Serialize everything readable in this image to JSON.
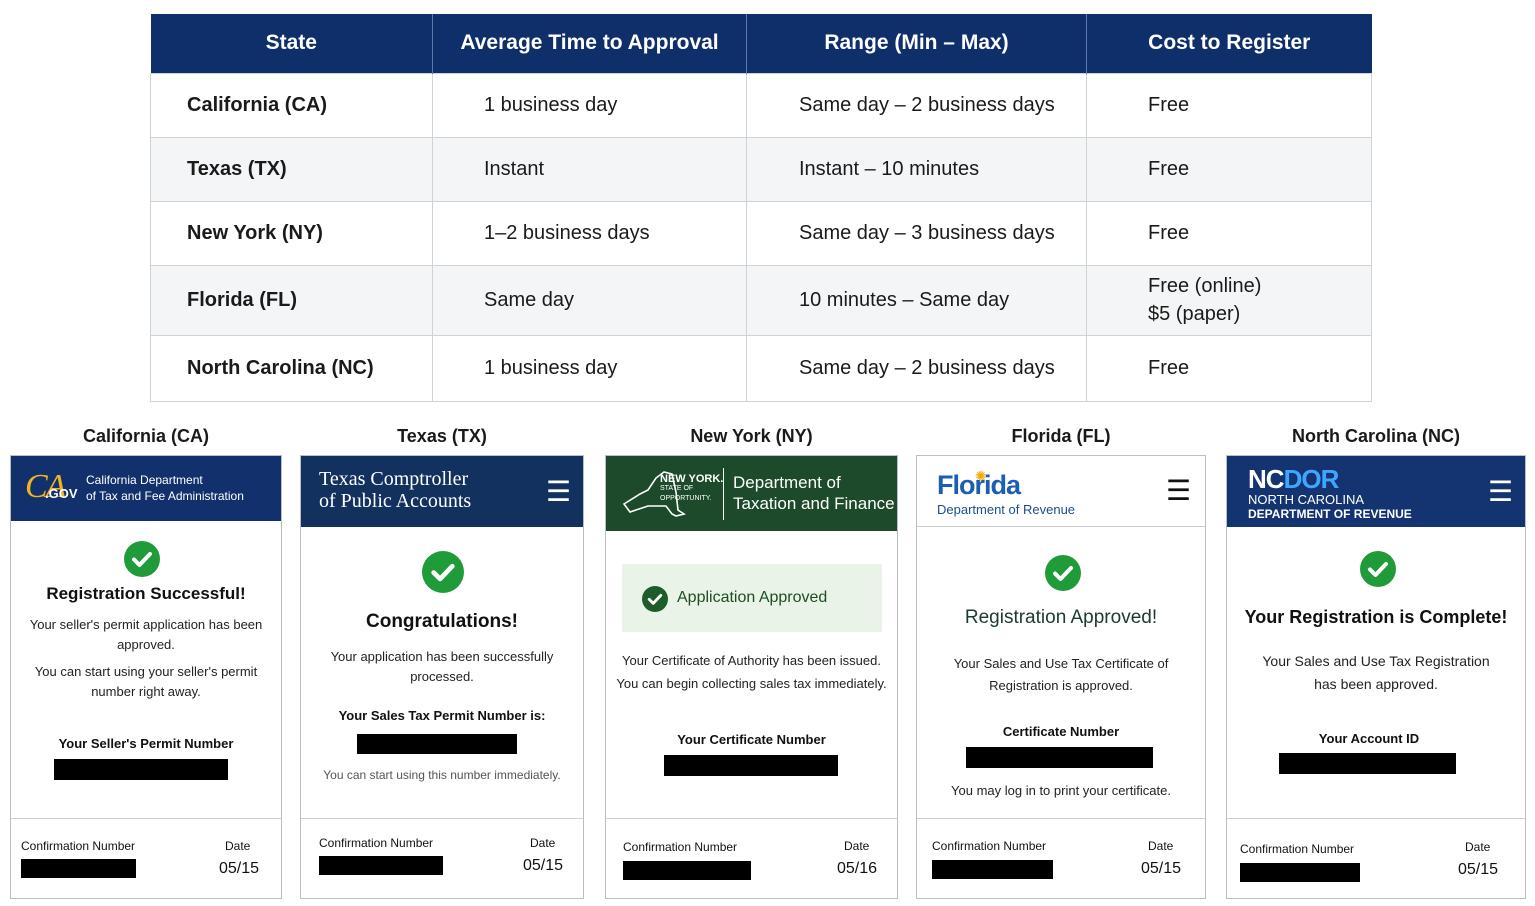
{
  "table": {
    "headers": [
      "State",
      "Average Time to Approval",
      "Range (Min – Max)",
      "Cost to Register"
    ],
    "rows": [
      {
        "state": "California (CA)",
        "avg": "1 business day",
        "range": "Same day – 2 business days",
        "cost": [
          "Free"
        ]
      },
      {
        "state": "Texas (TX)",
        "avg": "Instant",
        "range": "Instant – 10 minutes",
        "cost": [
          "Free"
        ]
      },
      {
        "state": "New York (NY)",
        "avg": "1–2 business days",
        "range": "Same day – 3 business days",
        "cost": [
          "Free"
        ]
      },
      {
        "state": "Florida (FL)",
        "avg": "Same day",
        "range": "10 minutes – Same day",
        "cost": [
          "Free (online)",
          "$5 (paper)"
        ]
      },
      {
        "state": "North Carolina (NC)",
        "avg": "1 business day",
        "range": "Same day – 2 business days",
        "cost": [
          "Free"
        ]
      }
    ]
  },
  "colors": {
    "table_header": "#0f2f6b",
    "success_green": "#1f9b3a",
    "ca_header": "#12306b",
    "tx_header": "#13315f",
    "ny_header": "#1d4a2b",
    "nc_header": "#133470",
    "fl_blue": "#1a5fb4"
  },
  "cards": {
    "ca": {
      "label": "California (CA)",
      "logo": "CA",
      "logo_suffix": ".GOV",
      "agency_line1": "California Department",
      "agency_line2": "of Tax and Fee Administration",
      "heading": "Registration Successful!",
      "msg1a": "Your seller's permit application has been",
      "msg1b": "approved.",
      "msg2a": "You can start using your seller's permit",
      "msg2b": "number right away.",
      "number_label": "Your Seller's Permit Number",
      "confirmation_label": "Confirmation Number",
      "date_label": "Date",
      "date": "05/15",
      "icon": "check-circle-icon"
    },
    "tx": {
      "label": "Texas (TX)",
      "agency_line1": "Texas Comptroller",
      "agency_line2": "of Public Accounts",
      "heading": "Congratulations!",
      "msg1a": "Your application has been successfully",
      "msg1b": "processed.",
      "number_label": "Your Sales Tax Permit Number is:",
      "note": "You can start using this number immediately.",
      "confirmation_label": "Confirmation Number",
      "date_label": "Date",
      "date": "05/15",
      "icon": "check-circle-icon"
    },
    "ny": {
      "label": "New York (NY)",
      "brand": "NEW YORK.",
      "brand_sub1": "STATE OF",
      "brand_sub2": "OPPORTUNITY.",
      "agency_line1": "Department of",
      "agency_line2": "Taxation and Finance",
      "banner": "Application Approved",
      "msg1": "Your Certificate of Authority has been issued.",
      "msg2": "You can begin collecting sales tax immediately.",
      "number_label": "Your Certificate Number",
      "confirmation_label": "Confirmation Number",
      "date_label": "Date",
      "date": "05/16",
      "icon": "check-circle-icon"
    },
    "fl": {
      "label": "Florida (FL)",
      "logo": "Florida",
      "agency": "Department of Revenue",
      "heading": "Registration Approved!",
      "msg1a": "Your Sales and Use Tax Certificate of",
      "msg1b": "Registration is approved.",
      "number_label": "Certificate Number",
      "note": "You may log in to print your certificate.",
      "confirmation_label": "Confirmation Number",
      "date_label": "Date",
      "date": "05/15",
      "icon": "check-circle-icon"
    },
    "nc": {
      "label": "North Carolina (NC)",
      "logo_nc": "NC",
      "logo_dor": "DOR",
      "agency_line1": "NORTH CAROLINA",
      "agency_line2": "DEPARTMENT OF REVENUE",
      "heading": "Your Registration is Complete!",
      "msg1a": "Your Sales and Use Tax Registration",
      "msg1b": "has been approved.",
      "number_label": "Your Account ID",
      "confirmation_label": "Confirmation Number",
      "date_label": "Date",
      "date": "05/15",
      "icon": "check-circle-icon"
    }
  }
}
